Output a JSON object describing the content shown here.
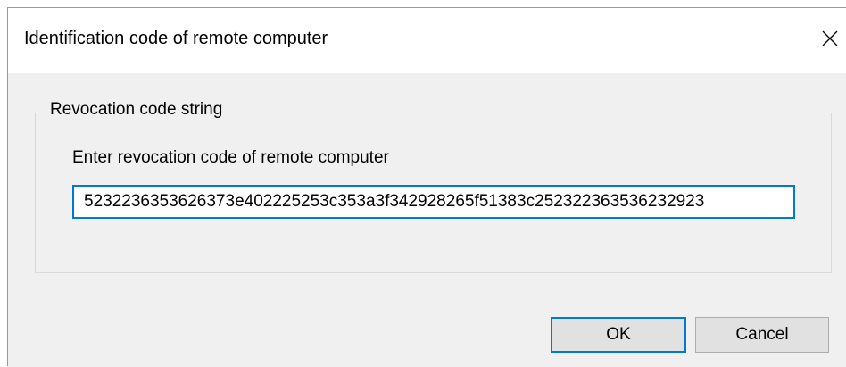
{
  "window": {
    "title": "Identification code of remote computer",
    "close_icon": "close-icon"
  },
  "group": {
    "legend": "Revocation code string",
    "prompt": "Enter revocation code of remote computer",
    "code_value": "5232236353626373e402225253c353a3f342928265f51383c252322363536232923"
  },
  "buttons": {
    "ok_label": "OK",
    "cancel_label": "Cancel"
  },
  "colors": {
    "focus_border": "#0078d7",
    "dialog_background": "#f0f0f0",
    "button_background": "#e1e1e1"
  }
}
